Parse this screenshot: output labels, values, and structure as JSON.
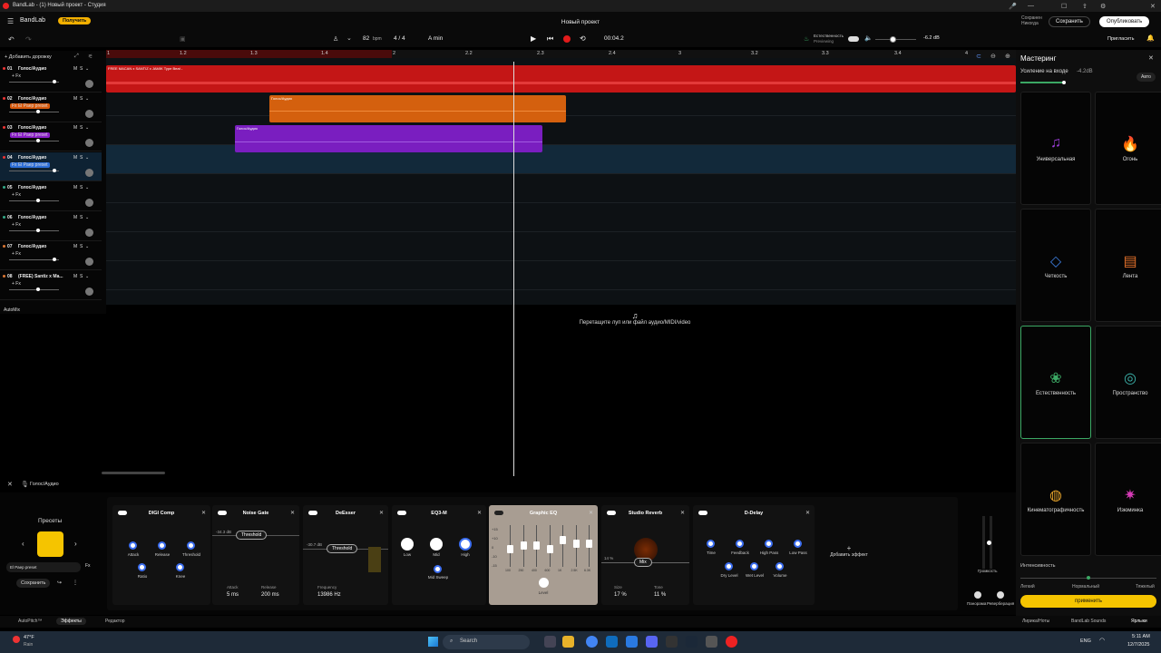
{
  "titlebar": {
    "title": "BandLab - (1) Новый проект - Студия"
  },
  "header": {
    "logo": "BandLab",
    "get_label": "Получить",
    "project_title": "Новый проект",
    "saved_label": "Сохранен",
    "saved_time": "Никогда",
    "save_label": "Сохранить",
    "publish_label": "Опубликовать"
  },
  "toolbar": {
    "bpm": "82",
    "bpm_unit": "bpm",
    "time_sig": "4 / 4",
    "key": "A min",
    "time": "00:04.2",
    "preset_label": "Естественность",
    "preset_sub": "Previewing",
    "db": "-6.2 dB",
    "invite_label": "Пригласить"
  },
  "tracklist": {
    "add_track": "+ Добавить дорожку",
    "automix": "AutoMix",
    "tracks": [
      {
        "num": "01",
        "name": "Голос/Аудио",
        "fx": "+ Fx",
        "fxbg": "",
        "dot": "#e33"
      },
      {
        "num": "02",
        "name": "Голос/Аудио",
        "fx": "Fx El Раер preset",
        "fxbg": "#d8590c",
        "dot": "#e33"
      },
      {
        "num": "03",
        "name": "Голос/Аудио",
        "fx": "Fx El Раер preset",
        "fxbg": "#8a1ec8",
        "dot": "#e33"
      },
      {
        "num": "04",
        "name": "Голос/Аудио",
        "fx": "Fx El Раер preset",
        "fxbg": "#2d6fd8",
        "dot": "#e33"
      },
      {
        "num": "05",
        "name": "Голос/Аудио",
        "fx": "+ Fx",
        "fxbg": "",
        "dot": "#3a8"
      },
      {
        "num": "06",
        "name": "Голос/Аудио",
        "fx": "+ Fx",
        "fxbg": "",
        "dot": "#3a8"
      },
      {
        "num": "07",
        "name": "Голос/Аудио",
        "fx": "+ Fx",
        "fxbg": "",
        "dot": "#d73"
      },
      {
        "num": "08",
        "name": "(FREE) Santiz x Ма...",
        "fx": "+ Fx",
        "fxbg": "",
        "dot": "#d73"
      }
    ]
  },
  "ruler": {
    "ticks": [
      "1",
      "1.2",
      "1.3",
      "1.4",
      "2",
      "2.2",
      "2.3",
      "2.4",
      "3",
      "3.2",
      "3.3",
      "3.4",
      "4"
    ]
  },
  "clips": {
    "c1": "FREE MACAN x SANTIZ x JAMIK Type Beat -",
    "c2": "Голос/Аудио",
    "c3": "Голос/Аудио"
  },
  "drop_hint": "Перетащите луп или файл аудио/MIDI/video",
  "mastering": {
    "title": "Мастеринг",
    "gain_label": "Усиление на входе",
    "gain_value": "-4.2dB",
    "auto": "Авто",
    "presets": [
      "Универсальная",
      "Огонь",
      "Четкость",
      "Лента",
      "Естественность",
      "Пространство",
      "Кинематографичность",
      "Изюминка"
    ],
    "intensity": "Интенсивность",
    "levels": [
      "Легкий",
      "Нормальный",
      "Тяжелый"
    ],
    "apply": "применить"
  },
  "fx": {
    "track_label": "Голос/Аудио",
    "presets_title": "Пресеты",
    "preset_name": "El Раер preset",
    "save": "Сохранить",
    "digicomp": {
      "name": "DIGI Comp",
      "k": [
        "Attack",
        "Release",
        "Threshold",
        "Ratio",
        "Knee"
      ]
    },
    "gate": {
      "name": "Noise Gate",
      "db": "-34.3 dB",
      "thr": "Threshold",
      "attack": "Attack",
      "attack_v": "5 ms",
      "release": "Release",
      "release_v": "200 ms"
    },
    "deesser": {
      "name": "DeEsser",
      "db": "-30.7 dB",
      "thr": "Threshold",
      "freq": "Frequency",
      "freq_v": "13986 Hz"
    },
    "eq3": {
      "name": "EQ3-M",
      "k": [
        "Low",
        "Mid",
        "High",
        "Mid Sweep"
      ]
    },
    "geq": {
      "name": "Graphic EQ",
      "level": "Level",
      "scale": [
        "+15",
        "+10",
        "0",
        "-10",
        "-15"
      ],
      "bands": [
        "100",
        "250",
        "400",
        "600",
        "1K",
        "2.5K",
        "6.3K"
      ]
    },
    "reverb": {
      "name": "Studio Reverb",
      "mix": "Mix",
      "size": "Size",
      "size_v": "17 %",
      "tone": "Tone",
      "tone_v": "11 %",
      "pct": "14 %"
    },
    "delay": {
      "name": "D-Delay",
      "k": [
        "Time",
        "Feedback",
        "High Pass",
        "Low Pass",
        "Dry Level",
        "Wet Level",
        "Volume"
      ]
    },
    "add": "Добавить эффект",
    "vol_label": "Громкость",
    "pan": "Панорама",
    "reverb_lbl": "Реверберация"
  },
  "bottom": {
    "autopitch": "AutoPitch™",
    "effects": "Эффекты",
    "editor": "Редактор",
    "lyrics": "Лирика/Ноты",
    "sounds": "BandLab Sounds",
    "shortcuts": "Ярлыки"
  },
  "taskbar": {
    "temp": "47°F",
    "weather": "Rain",
    "search": "Search",
    "lang": "ENG",
    "time": "5:11 AM",
    "date": "12/7/2025"
  }
}
